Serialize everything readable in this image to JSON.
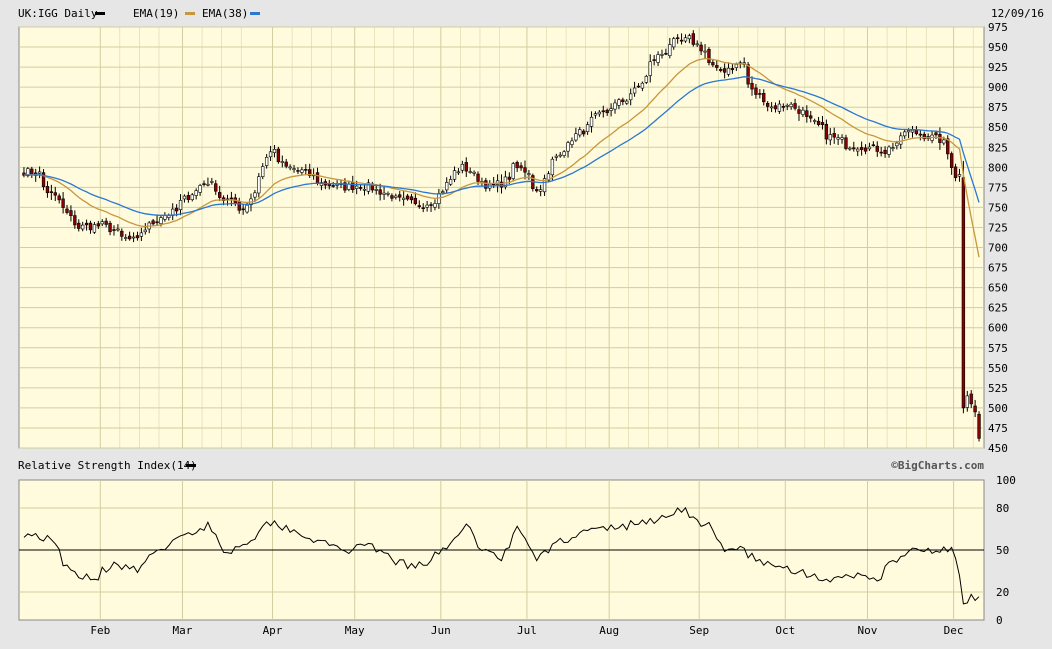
{
  "header": {
    "symbol": "UK:IGG Daily",
    "date": "12/09/16",
    "legend": [
      {
        "label": "",
        "color": "#000000"
      },
      {
        "label": "EMA(19)",
        "color": "#c8963c"
      },
      {
        "label": "EMA(38)",
        "color": "#2a78d2"
      }
    ]
  },
  "rsi_header": {
    "label": "Relative Strength Index(14)",
    "swatch_color": "#000000"
  },
  "credit": "©BigCharts.com",
  "colors": {
    "panel_bg": "#fffbdc",
    "grid": "#cfcfa0",
    "up_candle": "#ffffff",
    "down_candle": "#8b0000",
    "candle_outline": "#000000",
    "ema19": "#c8963c",
    "ema38": "#2a78d2",
    "rsi_line": "#000000"
  },
  "chart_data": [
    {
      "type": "candlestick",
      "title": "UK:IGG Daily",
      "ylim": [
        450,
        975
      ],
      "yticks": [
        450,
        475,
        500,
        525,
        550,
        575,
        600,
        625,
        650,
        675,
        700,
        725,
        750,
        775,
        800,
        825,
        850,
        875,
        900,
        925,
        950,
        975
      ],
      "months": [
        "Feb",
        "Mar",
        "Apr",
        "May",
        "Jun",
        "Jul",
        "Aug",
        "Sep",
        "Oct",
        "Nov",
        "Dec"
      ],
      "month_ticks": [
        "2016-01-29",
        "2016-02-29",
        "2016-03-31",
        "2016-04-29",
        "2016-05-31",
        "2016-06-30",
        "2016-07-29",
        "2016-08-31",
        "2016-09-30",
        "2016-10-31",
        "2016-11-30"
      ],
      "start": "2016-01-04",
      "end": "2016-12-09",
      "close_anchors": [
        [
          "2016-01-04",
          795
        ],
        [
          "2016-01-08",
          792
        ],
        [
          "2016-01-12",
          770
        ],
        [
          "2016-01-18",
          748
        ],
        [
          "2016-01-22",
          725
        ],
        [
          "2016-02-01",
          728
        ],
        [
          "2016-02-08",
          712
        ],
        [
          "2016-02-12",
          708
        ],
        [
          "2016-02-19",
          735
        ],
        [
          "2016-02-26",
          745
        ],
        [
          "2016-03-03",
          768
        ],
        [
          "2016-03-09",
          782
        ],
        [
          "2016-03-15",
          760
        ],
        [
          "2016-03-22",
          748
        ],
        [
          "2016-03-28",
          790
        ],
        [
          "2016-03-31",
          822
        ],
        [
          "2016-04-06",
          800
        ],
        [
          "2016-04-12",
          795
        ],
        [
          "2016-04-19",
          780
        ],
        [
          "2016-04-26",
          775
        ],
        [
          "2016-05-03",
          778
        ],
        [
          "2016-05-10",
          770
        ],
        [
          "2016-05-16",
          760
        ],
        [
          "2016-05-23",
          752
        ],
        [
          "2016-05-30",
          760
        ],
        [
          "2016-06-03",
          785
        ],
        [
          "2016-06-08",
          800
        ],
        [
          "2016-06-13",
          790
        ],
        [
          "2016-06-17",
          775
        ],
        [
          "2016-06-22",
          780
        ],
        [
          "2016-06-27",
          800
        ],
        [
          "2016-07-01",
          795
        ],
        [
          "2016-07-05",
          770
        ],
        [
          "2016-07-08",
          790
        ],
        [
          "2016-07-13",
          820
        ],
        [
          "2016-07-19",
          840
        ],
        [
          "2016-07-26",
          862
        ],
        [
          "2016-08-02",
          878
        ],
        [
          "2016-08-09",
          895
        ],
        [
          "2016-08-16",
          935
        ],
        [
          "2016-08-22",
          955
        ],
        [
          "2016-08-29",
          960
        ],
        [
          "2016-09-02",
          945
        ],
        [
          "2016-09-07",
          920
        ],
        [
          "2016-09-13",
          925
        ],
        [
          "2016-09-16",
          930
        ],
        [
          "2016-09-20",
          895
        ],
        [
          "2016-09-27",
          875
        ],
        [
          "2016-10-03",
          880
        ],
        [
          "2016-10-10",
          860
        ],
        [
          "2016-10-17",
          840
        ],
        [
          "2016-10-24",
          828
        ],
        [
          "2016-10-31",
          825
        ],
        [
          "2016-11-07",
          820
        ],
        [
          "2016-11-14",
          845
        ],
        [
          "2016-11-21",
          840
        ],
        [
          "2016-11-28",
          830
        ],
        [
          "2016-12-01",
          790
        ],
        [
          "2016-12-02",
          790
        ],
        [
          "2016-12-05",
          500
        ],
        [
          "2016-12-06",
          515
        ],
        [
          "2016-12-07",
          505
        ],
        [
          "2016-12-08",
          495
        ],
        [
          "2016-12-09",
          462
        ]
      ]
    },
    {
      "type": "line",
      "title": "Relative Strength Index(14)",
      "ylim": [
        0,
        100
      ],
      "yticks": [
        0,
        20,
        50,
        80,
        100
      ],
      "reference_line": 50,
      "anchors": [
        [
          "2016-01-04",
          62
        ],
        [
          "2016-01-12",
          58
        ],
        [
          "2016-01-20",
          34
        ],
        [
          "2016-01-29",
          30
        ],
        [
          "2016-02-05",
          42
        ],
        [
          "2016-02-12",
          35
        ],
        [
          "2016-02-22",
          52
        ],
        [
          "2016-03-01",
          60
        ],
        [
          "2016-03-09",
          68
        ],
        [
          "2016-03-16",
          48
        ],
        [
          "2016-03-24",
          58
        ],
        [
          "2016-03-31",
          70
        ],
        [
          "2016-04-08",
          65
        ],
        [
          "2016-04-18",
          55
        ],
        [
          "2016-04-28",
          50
        ],
        [
          "2016-05-06",
          52
        ],
        [
          "2016-05-13",
          45
        ],
        [
          "2016-05-20",
          38
        ],
        [
          "2016-05-27",
          40
        ],
        [
          "2016-06-03",
          55
        ],
        [
          "2016-06-09",
          66
        ],
        [
          "2016-06-16",
          50
        ],
        [
          "2016-06-22",
          45
        ],
        [
          "2016-06-28",
          65
        ],
        [
          "2016-07-05",
          43
        ],
        [
          "2016-07-11",
          55
        ],
        [
          "2016-07-20",
          62
        ],
        [
          "2016-07-28",
          65
        ],
        [
          "2016-08-05",
          67
        ],
        [
          "2016-08-12",
          70
        ],
        [
          "2016-08-19",
          73
        ],
        [
          "2016-08-25",
          80
        ],
        [
          "2016-08-31",
          70
        ],
        [
          "2016-09-05",
          67
        ],
        [
          "2016-09-09",
          48
        ],
        [
          "2016-09-16",
          52
        ],
        [
          "2016-09-23",
          40
        ],
        [
          "2016-09-30",
          38
        ],
        [
          "2016-10-07",
          35
        ],
        [
          "2016-10-14",
          30
        ],
        [
          "2016-10-21",
          28
        ],
        [
          "2016-10-28",
          32
        ],
        [
          "2016-11-04",
          30
        ],
        [
          "2016-11-11",
          45
        ],
        [
          "2016-11-18",
          50
        ],
        [
          "2016-11-25",
          48
        ],
        [
          "2016-11-30",
          52
        ],
        [
          "2016-12-02",
          30
        ],
        [
          "2016-12-05",
          10
        ],
        [
          "2016-12-07",
          16
        ],
        [
          "2016-12-09",
          14
        ]
      ]
    }
  ]
}
